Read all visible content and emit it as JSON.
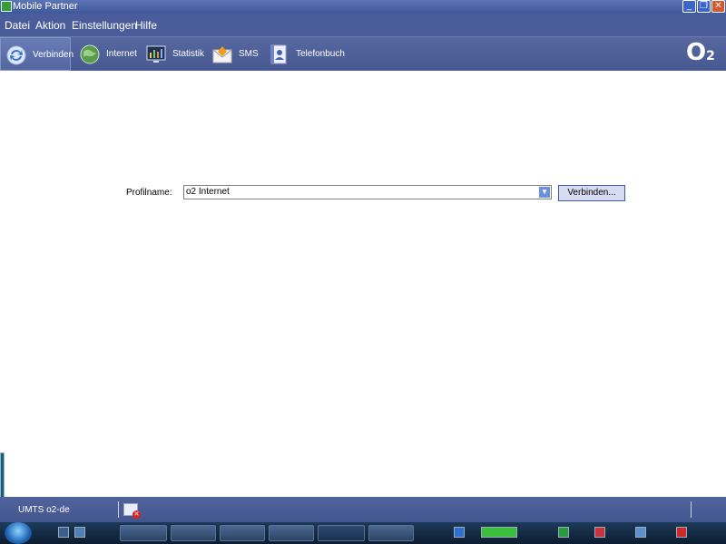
{
  "window": {
    "title": "Mobile Partner"
  },
  "menu": [
    "Datei",
    "Aktion",
    "Einstellungen",
    "Hilfe"
  ],
  "toolbar": [
    {
      "label": "Verbinden",
      "icon": "connect-icon",
      "active": true
    },
    {
      "label": "Internet",
      "icon": "globe-icon",
      "active": false
    },
    {
      "label": "Statistik",
      "icon": "statistics-icon",
      "active": false
    },
    {
      "label": "SMS",
      "icon": "sms-icon",
      "active": false
    },
    {
      "label": "Telefonbuch",
      "icon": "phonebook-icon",
      "active": false
    }
  ],
  "logo": {
    "text": "O",
    "subscript": "2"
  },
  "profile": {
    "label": "Profilname:",
    "selected": "o2 Internet",
    "connect_button": "Verbinden..."
  },
  "status": {
    "network": "UMTS  o2-de"
  },
  "colors": {
    "title_bar": "#4a64a8",
    "menu_bar": "#4a5d9a",
    "toolbar": "#4e6097",
    "status_bar": "#4b5d94",
    "taskbar": "#14283f",
    "button_fill": "#d6dcf2"
  }
}
